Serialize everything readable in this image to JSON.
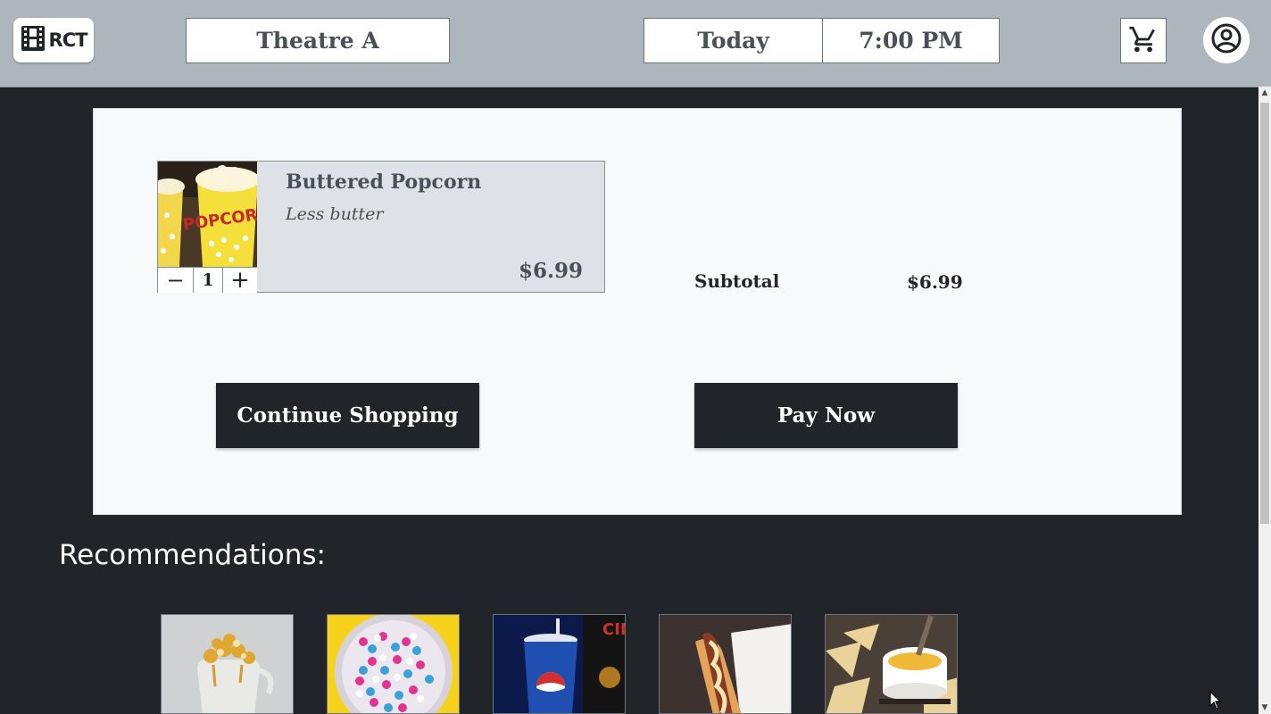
{
  "header": {
    "logo_text": "RCT",
    "theatre": "Theatre A",
    "date": "Today",
    "time": "7:00 PM",
    "icons": {
      "logo": "film-strip-icon",
      "cart": "cart-icon",
      "user": "user-circle-icon"
    }
  },
  "cart": {
    "items": [
      {
        "name": "Buttered Popcorn",
        "note": "Less butter",
        "price": "$6.99",
        "quantity": "1",
        "minus_symbol": "−",
        "plus_symbol": "+",
        "image": "popcorn-image"
      }
    ],
    "subtotal_label": "Subtotal",
    "subtotal_value": "$6.99",
    "continue_label": "Continue Shopping",
    "pay_label": "Pay Now"
  },
  "recommendations": {
    "title": "Recommendations:",
    "items": [
      {
        "image": "caramel-popcorn-image"
      },
      {
        "image": "candy-bowl-image"
      },
      {
        "image": "soda-cup-image"
      },
      {
        "image": "hot-dog-image"
      },
      {
        "image": "nachos-cheese-image"
      }
    ]
  },
  "colors": {
    "header_bg": "#adb5bd",
    "page_bg": "#212529",
    "card_bg": "#f8f9fa",
    "item_bg": "#dee2e6",
    "button_bg": "#212529"
  }
}
